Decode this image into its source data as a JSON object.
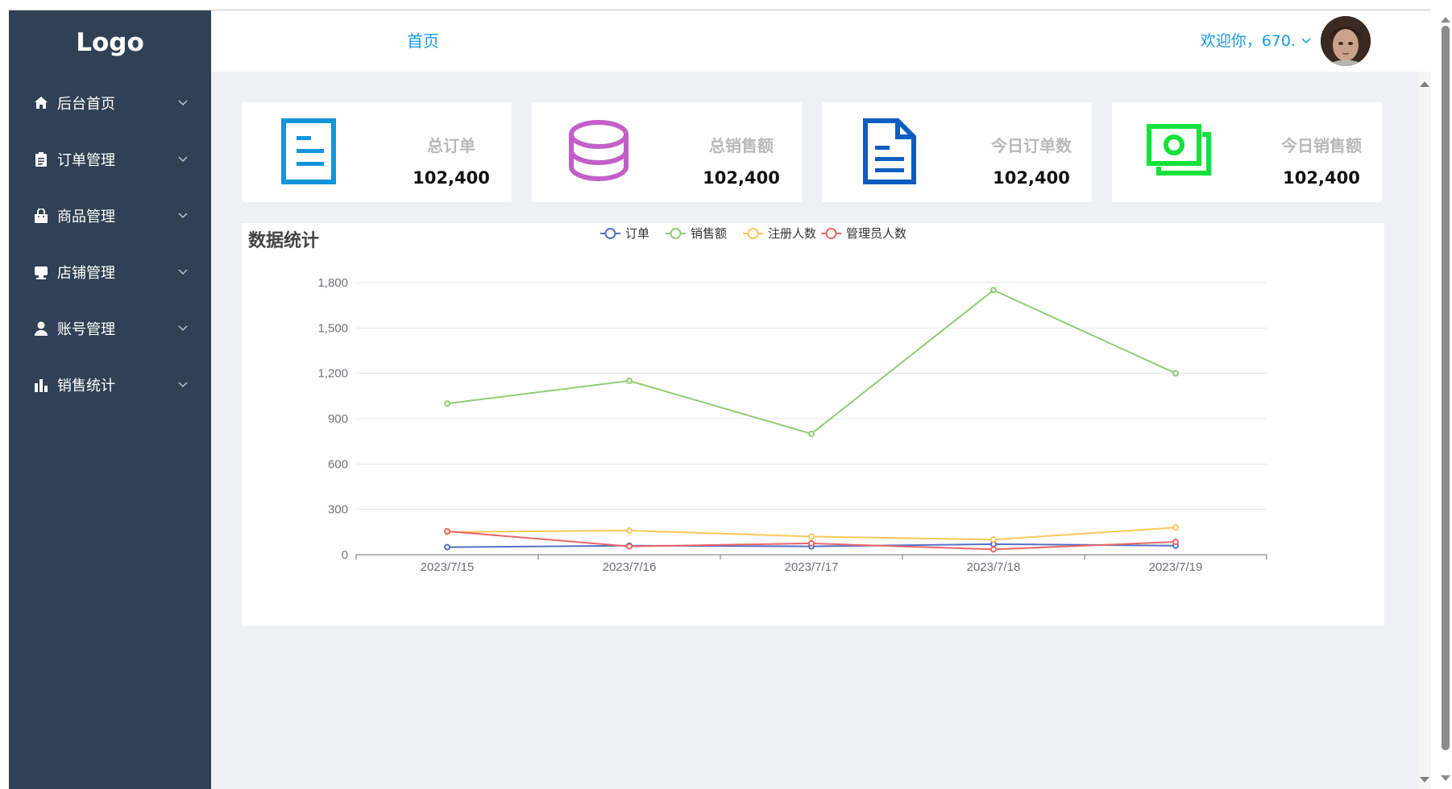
{
  "sidebar": {
    "logo": "Logo",
    "items": [
      {
        "label": "后台首页",
        "icon": "home-icon"
      },
      {
        "label": "订单管理",
        "icon": "clipboard-icon"
      },
      {
        "label": "商品管理",
        "icon": "shopping-bag-icon"
      },
      {
        "label": "店铺管理",
        "icon": "store-icon"
      },
      {
        "label": "账号管理",
        "icon": "user-icon"
      },
      {
        "label": "销售统计",
        "icon": "bar-chart-icon"
      }
    ]
  },
  "header": {
    "breadcrumb": "首页",
    "welcome": "欢迎你，670."
  },
  "cards": [
    {
      "label": "总订单",
      "value": "102,400",
      "icon": "document-icon",
      "color": "#1296db"
    },
    {
      "label": "总销售额",
      "value": "102,400",
      "icon": "database-icon",
      "color": "#c35fc8"
    },
    {
      "label": "今日订单数",
      "value": "102,400",
      "icon": "file-icon",
      "color": "#0d5dbf"
    },
    {
      "label": "今日销售额",
      "value": "102,400",
      "icon": "money-icon",
      "color": "#14e23a"
    }
  ],
  "chart_title": "数据统计",
  "chart_data": {
    "type": "line",
    "x": [
      "2023/7/15",
      "2023/7/16",
      "2023/7/17",
      "2023/7/18",
      "2023/7/19"
    ],
    "ylim": [
      0,
      1800
    ],
    "yticks": [
      0,
      300,
      600,
      900,
      1200,
      1500,
      1800
    ],
    "ytick_labels": [
      "0",
      "300",
      "600",
      "900",
      "1,200",
      "1,500",
      "1,800"
    ],
    "grid": true,
    "legend_position": "top-center",
    "series": [
      {
        "name": "订单",
        "color": "#5470c6",
        "values": [
          50,
          60,
          55,
          70,
          60
        ]
      },
      {
        "name": "销售额",
        "color": "#91cc75",
        "values": [
          1000,
          1150,
          800,
          1750,
          1200
        ]
      },
      {
        "name": "注册人数",
        "color": "#fac858",
        "values": [
          150,
          160,
          120,
          100,
          180
        ]
      },
      {
        "name": "管理员人数",
        "color": "#ee6666",
        "values": [
          155,
          55,
          75,
          35,
          85
        ]
      }
    ]
  }
}
